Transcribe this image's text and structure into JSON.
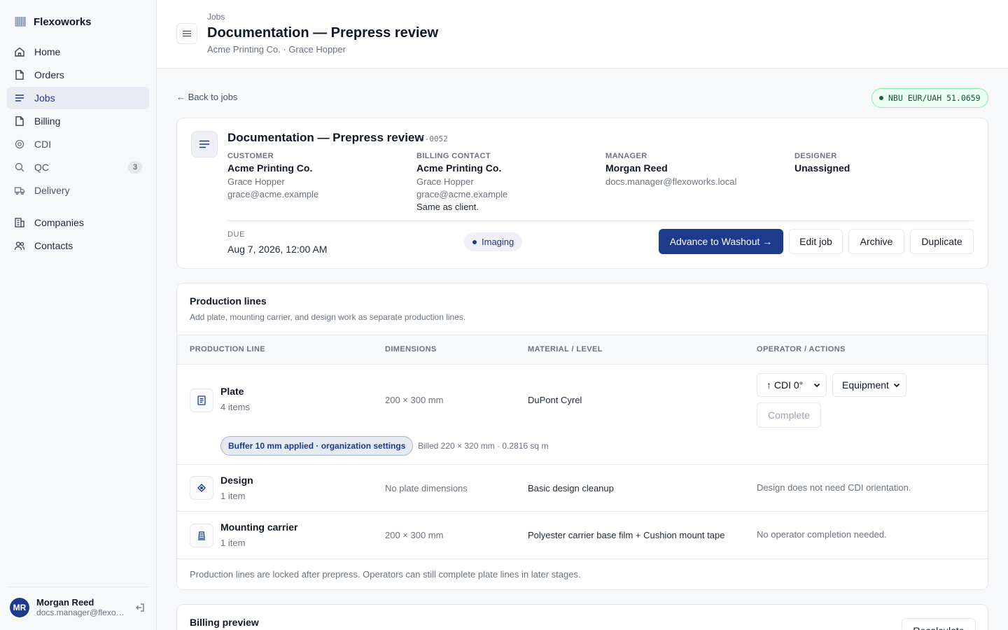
{
  "app": {
    "name": "Flexoworks"
  },
  "sidebar": {
    "items": [
      {
        "label": "Home",
        "icon": "home-icon"
      },
      {
        "label": "Orders",
        "icon": "file-icon"
      },
      {
        "label": "Jobs",
        "icon": "list-icon",
        "active": true
      },
      {
        "label": "Billing",
        "icon": "file-icon"
      },
      {
        "label": "CDI",
        "icon": "target-icon"
      },
      {
        "label": "QC",
        "icon": "search-icon",
        "badge": "3"
      },
      {
        "label": "Delivery",
        "icon": "truck-icon"
      },
      {
        "label": "Companies",
        "icon": "building-icon"
      },
      {
        "label": "Contacts",
        "icon": "users-icon"
      }
    ],
    "user": {
      "initials": "MR",
      "name": "Morgan Reed",
      "email": "docs.manager@flexoworks.local"
    }
  },
  "header": {
    "breadcrumb": "Jobs",
    "title": "Documentation — Prepress review",
    "subtitle": "Acme Printing Co. · Grace Hopper"
  },
  "main": {
    "back_label": "← Back to jobs",
    "rate_badge": "NBU EUR/UAH 51.0659"
  },
  "job": {
    "title": "Documentation — Prepress review",
    "code": "J-0052",
    "customer": {
      "label": "CUSTOMER",
      "company": "Acme Printing Co.",
      "contact": "Grace Hopper",
      "email": "grace@acme.example"
    },
    "billing": {
      "label": "BILLING CONTACT",
      "company": "Acme Printing Co.",
      "contact": "Grace Hopper",
      "email": "grace@acme.example",
      "note": "Same as client."
    },
    "manager": {
      "label": "MANAGER",
      "name": "Morgan Reed",
      "email": "docs.manager@flexoworks.local"
    },
    "designer": {
      "label": "DESIGNER",
      "name": "Unassigned"
    },
    "due_label": "DUE",
    "due_value": "Aug 7, 2026, 12:00 AM",
    "stage": "Imaging",
    "actions": {
      "advance": "Advance to Washout →",
      "edit": "Edit job",
      "archive": "Archive",
      "duplicate": "Duplicate"
    }
  },
  "production": {
    "title": "Production lines",
    "subtitle": "Add plate, mounting carrier, and design work as separate production lines.",
    "columns": [
      "PRODUCTION LINE",
      "DIMENSIONS",
      "MATERIAL / LEVEL",
      "OPERATOR / ACTIONS"
    ],
    "rows": [
      {
        "name": "Plate",
        "count": "4 items",
        "dimensions": "200 × 300 mm",
        "material": "DuPont Cyrel",
        "orientation": "↑ CDI 0°",
        "equipment": "Equipment",
        "complete": "Complete",
        "buffer": "Buffer 10 mm applied · organization settings",
        "billed": "Billed 220 × 320 mm · 0.2816 sq m"
      },
      {
        "name": "Design",
        "count": "1 item",
        "dimensions": "No plate dimensions",
        "material": "Basic design cleanup",
        "note": "Design does not need CDI orientation."
      },
      {
        "name": "Mounting carrier",
        "count": "1 item",
        "dimensions": "200 × 300 mm",
        "material": "Polyester carrier base film + Cushion mount tape",
        "note": "No operator completion needed."
      }
    ],
    "footer": "Production lines are locked after prepress. Operators can still complete plate lines in later stages."
  },
  "billing_preview": {
    "title": "Billing preview",
    "recalculate": "Recalculate"
  },
  "colors": {
    "accent": "#1e3a8a",
    "rate_bg": "#ecfdf3",
    "rate_border": "#86efac"
  }
}
